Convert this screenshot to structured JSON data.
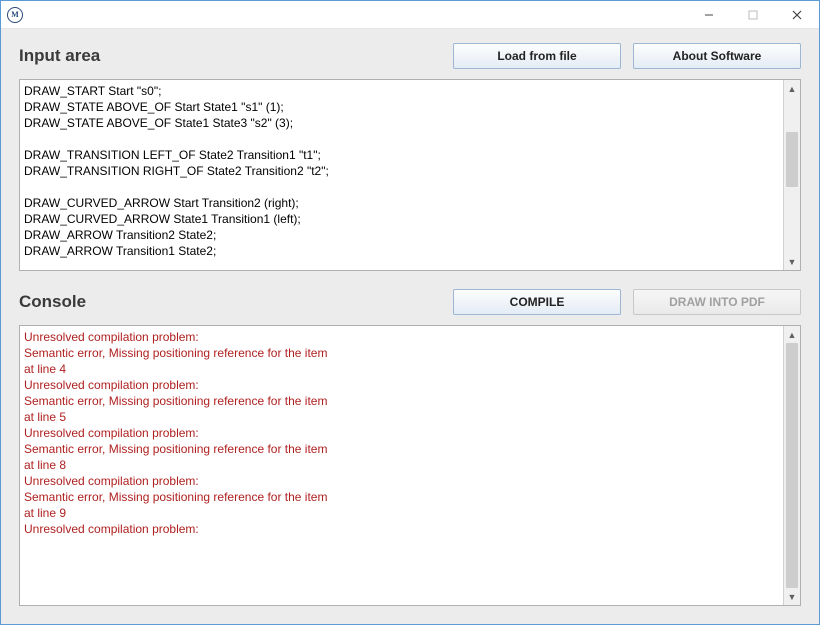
{
  "titlebar": {
    "app_icon_label": "M"
  },
  "input_section": {
    "title": "Input area",
    "load_button": "Load from file",
    "about_button": "About Software",
    "code": "DRAW_START Start \"s0\";\nDRAW_STATE ABOVE_OF Start State1 \"s1\" (1);\nDRAW_STATE ABOVE_OF State1 State3 \"s2\" (3);\n\nDRAW_TRANSITION LEFT_OF State2 Transition1 \"t1\";\nDRAW_TRANSITION RIGHT_OF State2 Transition2 \"t2\";\n\nDRAW_CURVED_ARROW Start Transition2 (right);\nDRAW_CURVED_ARROW State1 Transition1 (left);\nDRAW_ARROW Transition2 State2;\nDRAW_ARROW Transition1 State2;"
  },
  "console_section": {
    "title": "Console",
    "compile_button": "COMPILE",
    "draw_pdf_button": "DRAW INTO PDF",
    "output": "Unresolved compilation problem:\nSemantic error, Missing positioning reference for the item\nat line 4\nUnresolved compilation problem:\nSemantic error, Missing positioning reference for the item\nat line 5\nUnresolved compilation problem:\nSemantic error, Missing positioning reference for the item\nat line 8\nUnresolved compilation problem:\nSemantic error, Missing positioning reference for the item\nat line 9\nUnresolved compilation problem:"
  }
}
